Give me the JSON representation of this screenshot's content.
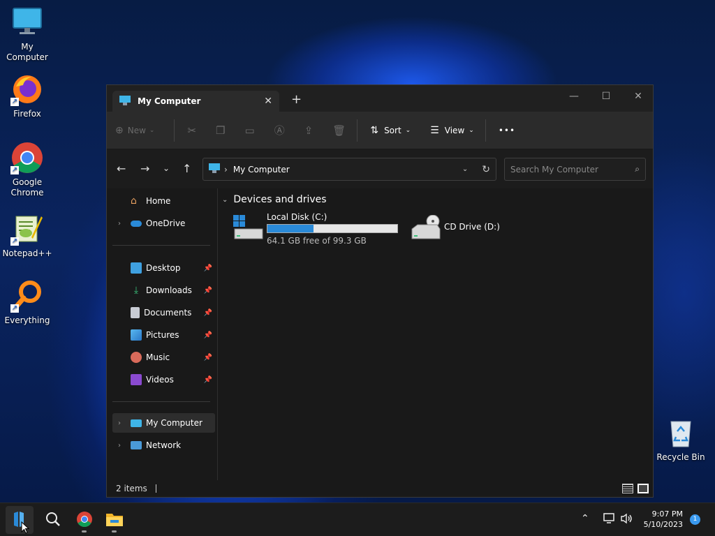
{
  "desktop": {
    "icons": [
      {
        "label": "My Computer",
        "icon": "monitor-icon"
      },
      {
        "label": "Firefox",
        "icon": "firefox-icon"
      },
      {
        "label": "Google Chrome",
        "icon": "chrome-icon"
      },
      {
        "label": "Notepad++",
        "icon": "notepadpp-icon"
      },
      {
        "label": "Everything",
        "icon": "everything-search-icon"
      },
      {
        "label": "Recycle Bin",
        "icon": "recycle-bin-icon"
      }
    ]
  },
  "window": {
    "tab_title": "My Computer",
    "close_tab_glyph": "✕",
    "new_tab_glyph": "+",
    "controls": {
      "minimize": "—",
      "maximize": "☐",
      "close": "✕"
    },
    "toolbar": {
      "new_label": "New",
      "sort_label": "Sort",
      "view_label": "View",
      "more_label": "•••"
    },
    "address": {
      "path_label": "My Computer",
      "search_placeholder": "Search My Computer"
    },
    "sidebar": {
      "items": [
        {
          "label": "Home",
          "icon": "home-icon"
        },
        {
          "label": "OneDrive",
          "icon": "onedrive-icon"
        },
        {
          "label": "Desktop",
          "icon": "desktop-folder-icon",
          "pinned": true
        },
        {
          "label": "Downloads",
          "icon": "download-icon",
          "pinned": true
        },
        {
          "label": "Documents",
          "icon": "documents-icon",
          "pinned": true
        },
        {
          "label": "Pictures",
          "icon": "pictures-icon",
          "pinned": true
        },
        {
          "label": "Music",
          "icon": "music-icon",
          "pinned": true
        },
        {
          "label": "Videos",
          "icon": "videos-icon",
          "pinned": true
        },
        {
          "label": "My Computer",
          "icon": "monitor-icon",
          "selected": true
        },
        {
          "label": "Network",
          "icon": "network-icon"
        }
      ]
    },
    "content": {
      "section_title": "Devices and drives",
      "drives": [
        {
          "name": "Local Disk (C:)",
          "free_text": "64.1 GB free of 99.3 GB",
          "used_fraction": 0.355
        },
        {
          "name": "CD Drive (D:)"
        }
      ]
    },
    "status": {
      "items_text": "2 items"
    }
  },
  "taskbar": {
    "time": "9:07 PM",
    "date": "5/10/2023",
    "notification_count": "1"
  }
}
